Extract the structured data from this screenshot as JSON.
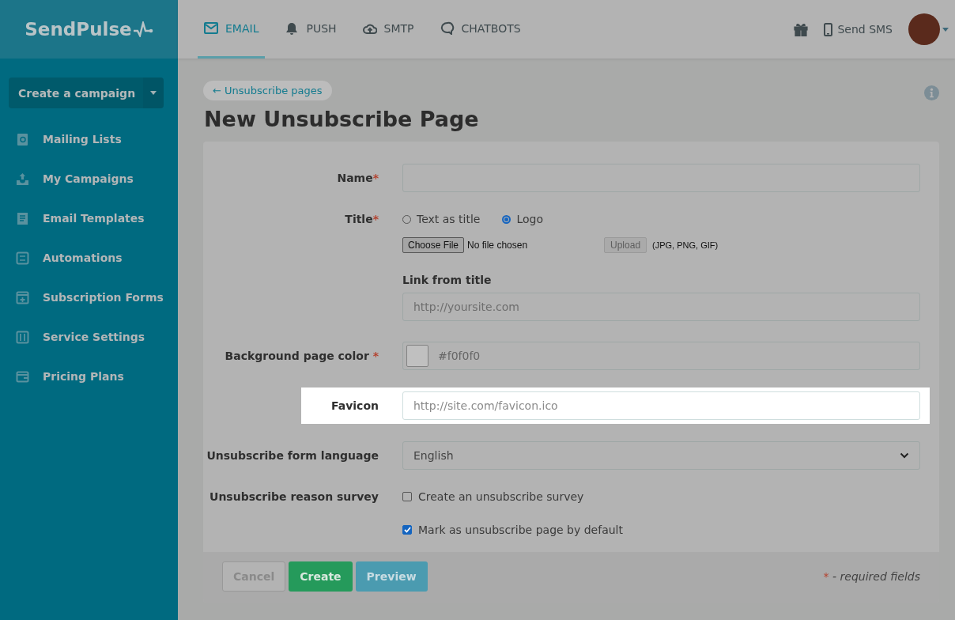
{
  "logo": {
    "text": "SendPulse"
  },
  "sidebar": {
    "create_button": "Create a campaign",
    "items": [
      {
        "label": "Mailing Lists"
      },
      {
        "label": "My Campaigns"
      },
      {
        "label": "Email Templates"
      },
      {
        "label": "Automations"
      },
      {
        "label": "Subscription Forms"
      },
      {
        "label": "Service Settings"
      },
      {
        "label": "Pricing Plans"
      }
    ]
  },
  "topbar": {
    "tabs": [
      {
        "label": "EMAIL",
        "selected": true
      },
      {
        "label": "PUSH",
        "selected": false
      },
      {
        "label": "SMTP",
        "selected": false
      },
      {
        "label": "CHATBOTS",
        "selected": false
      }
    ],
    "send_sms": "Send SMS"
  },
  "breadcrumb": "← Unsubscribe pages",
  "page_title": "New Unsubscribe Page",
  "form": {
    "rows": [
      {
        "kind": "text",
        "label": "Name",
        "required_mark": "*",
        "highlighted": false
      },
      {
        "kind": "radio",
        "label": "Title",
        "required_mark": "*",
        "highlighted": false,
        "options": [
          {
            "label": "Text as title",
            "selected": false
          },
          {
            "label": "Logo",
            "selected": true
          }
        ],
        "file": {
          "button": "Choose File",
          "status": "No file chosen",
          "upload": "Upload",
          "formats": "(JPG, PNG, GIF)"
        }
      },
      {
        "kind": "stacked",
        "sublabel": "Link from title",
        "placeholder": "http://yoursite.com",
        "highlighted": false
      },
      {
        "kind": "color",
        "label": "Background page color",
        "required_mark": "*",
        "value": "#f0f0f0",
        "highlighted": false
      },
      {
        "kind": "text",
        "label": "Favicon",
        "placeholder": "http://site.com/favicon.ico",
        "highlighted": true
      },
      {
        "kind": "select",
        "label": "Unsubscribe form language",
        "value": "English",
        "highlighted": false
      },
      {
        "kind": "checkbox",
        "label": "Unsubscribe reason survey",
        "text": "Create an unsubscribe survey",
        "checked": false,
        "highlighted": false
      },
      {
        "kind": "checkbox",
        "text": "Mark as unsubscribe page by default",
        "checked": true,
        "highlighted": false
      }
    ],
    "buttons": [
      {
        "label": "Cancel",
        "kind": "cancel"
      },
      {
        "label": "Create",
        "kind": "primary"
      },
      {
        "label": "Preview",
        "kind": "secondary"
      }
    ],
    "required_note": {
      "mark": "*",
      "text": "- required fields"
    }
  }
}
